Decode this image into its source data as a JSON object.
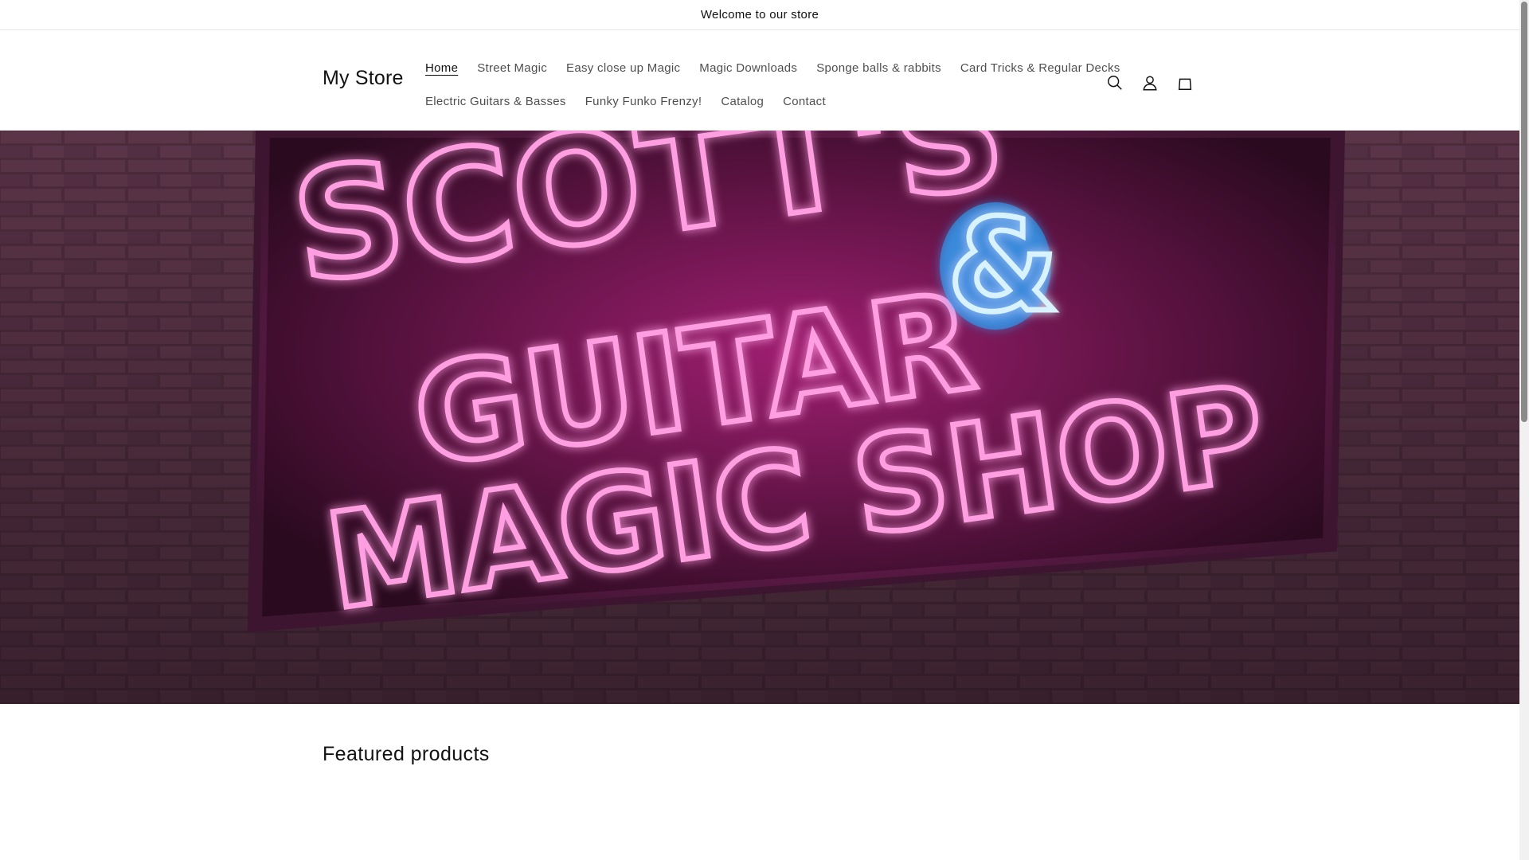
{
  "announcement": {
    "text": "Welcome to our store"
  },
  "header": {
    "logo": "My Store",
    "nav_row1": [
      {
        "label": "Home",
        "active": true
      },
      {
        "label": "Street Magic"
      },
      {
        "label": "Easy close up Magic"
      },
      {
        "label": "Magic Downloads"
      },
      {
        "label": "Sponge balls & rabbits"
      },
      {
        "label": "Card Tricks & Regular Decks"
      }
    ],
    "nav_row2": [
      {
        "label": "Electric Guitars & Basses"
      },
      {
        "label": "Funky Funko Frenzy!"
      },
      {
        "label": "Catalog"
      },
      {
        "label": "Contact"
      }
    ],
    "icons": [
      "search-icon",
      "account-icon",
      "cart-icon"
    ]
  },
  "hero": {
    "sign_line1": "SCOTT'S",
    "sign_line2": "GUITAR",
    "sign_ampersand": "&",
    "sign_line3": "MAGIC SHOP"
  },
  "featured": {
    "title": "Featured products"
  },
  "colors": {
    "neon_pink": "#ff2fb4",
    "neon_blue": "#2aa8ff",
    "text": "#121212"
  }
}
